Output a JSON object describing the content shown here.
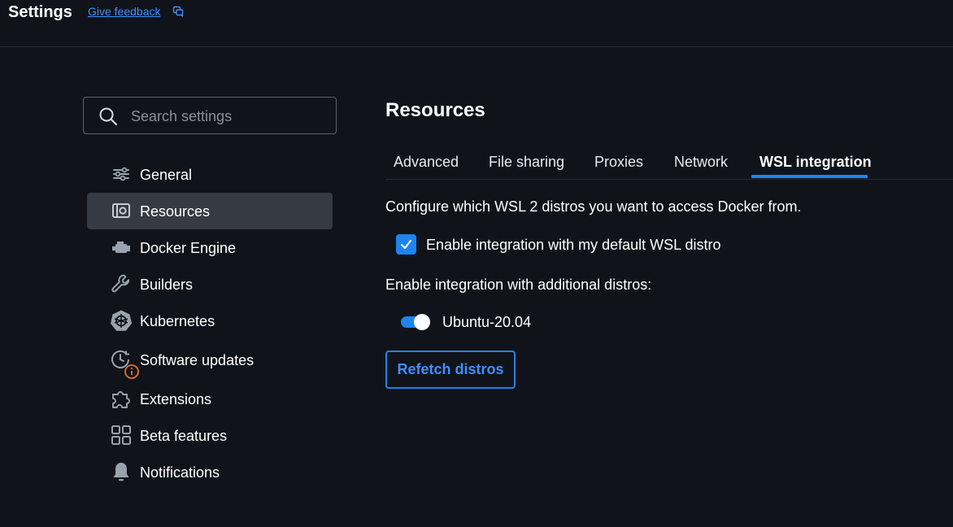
{
  "header": {
    "title": "Settings",
    "feedback_label": "Give feedback"
  },
  "search": {
    "placeholder": "Search settings",
    "value": ""
  },
  "sidebar": {
    "items": [
      {
        "label": "General",
        "icon": "sliders-icon",
        "active": false
      },
      {
        "label": "Resources",
        "icon": "resources-icon",
        "active": true
      },
      {
        "label": "Docker Engine",
        "icon": "engine-icon",
        "active": false
      },
      {
        "label": "Builders",
        "icon": "wrench-icon",
        "active": false
      },
      {
        "label": "Kubernetes",
        "icon": "kubernetes-icon",
        "active": false
      },
      {
        "label": "Software updates",
        "icon": "clock-update-icon",
        "active": false,
        "badge": "info"
      },
      {
        "label": "Extensions",
        "icon": "puzzle-icon",
        "active": false
      },
      {
        "label": "Beta features",
        "icon": "grid-icon",
        "active": false
      },
      {
        "label": "Notifications",
        "icon": "bell-icon",
        "active": false
      }
    ]
  },
  "main": {
    "title": "Resources",
    "tabs": [
      {
        "label": "Advanced",
        "active": false
      },
      {
        "label": "File sharing",
        "active": false
      },
      {
        "label": "Proxies",
        "active": false
      },
      {
        "label": "Network",
        "active": false
      },
      {
        "label": "WSL integration",
        "active": true
      }
    ],
    "description": "Configure which WSL 2 distros you want to access Docker from.",
    "default_distro": {
      "label": "Enable integration with my default WSL distro",
      "checked": true
    },
    "additional_label": "Enable integration with additional distros:",
    "distros": [
      {
        "name": "Ubuntu-20.04",
        "enabled": true
      }
    ],
    "refetch_label": "Refetch distros"
  },
  "colors": {
    "accent": "#1d84f0",
    "link": "#3f8fff",
    "background": "#10141a",
    "active_item": "#363b43",
    "badge": "#e8721c"
  }
}
